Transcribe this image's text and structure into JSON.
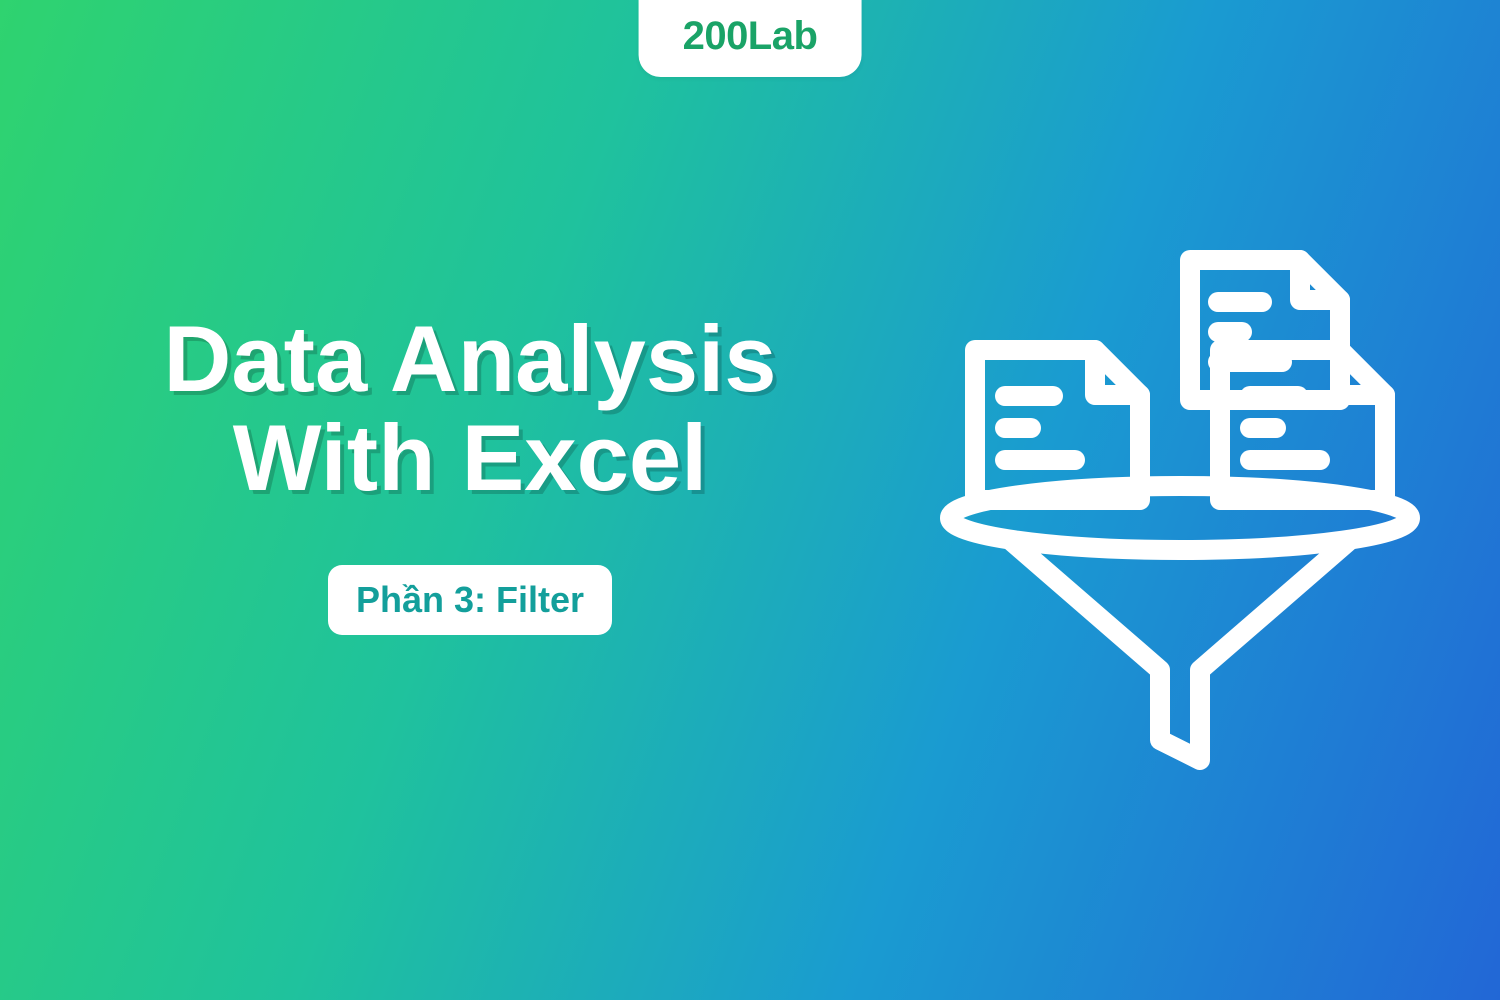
{
  "logo": {
    "text": "200Lab",
    "text_color": "#1aa367"
  },
  "headline": {
    "line1": "Data Analysis",
    "line2": "With Excel"
  },
  "subtitle": {
    "label": "Phần 3: Filter"
  },
  "colors": {
    "gradient_from": "#2fd36f",
    "gradient_to": "#2267d6",
    "badge_bg": "#ffffff",
    "title_color": "#ffffff",
    "subtitle_color": "#139f9b"
  }
}
